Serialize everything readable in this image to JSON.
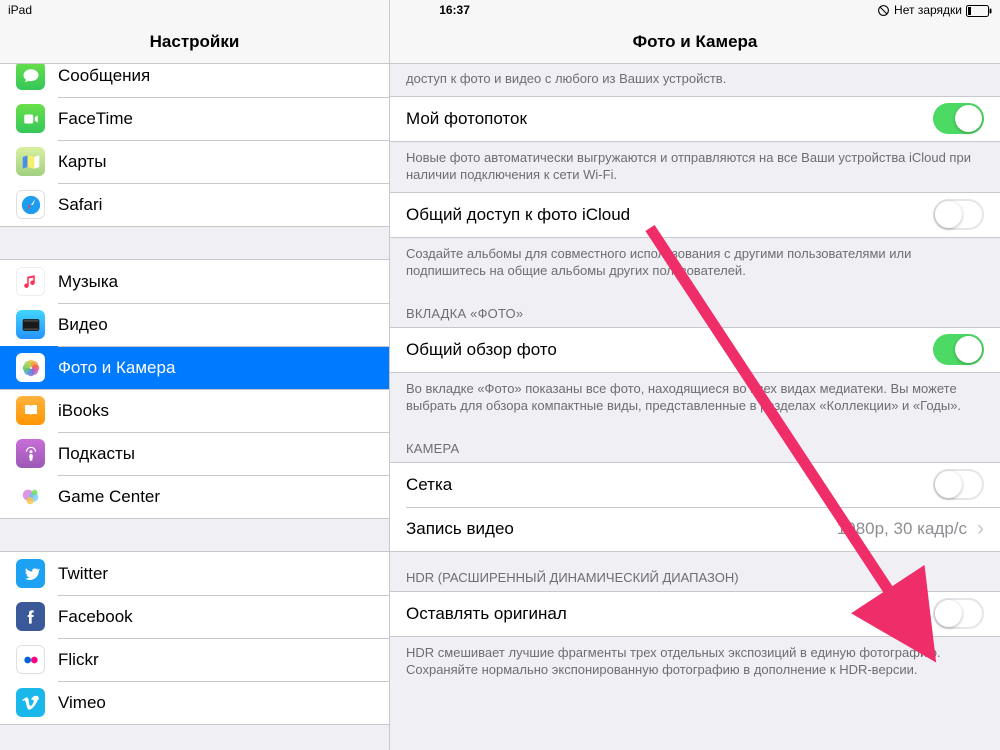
{
  "statusbar": {
    "device": "iPad",
    "time": "16:37",
    "charge_text": "Нет зарядки"
  },
  "sidebar": {
    "title": "Настройки",
    "group1": [
      {
        "id": "messages",
        "label": "Сообщения",
        "icon": "messages-icon"
      },
      {
        "id": "facetime",
        "label": "FaceTime",
        "icon": "facetime-icon"
      },
      {
        "id": "maps",
        "label": "Карты",
        "icon": "maps-icon"
      },
      {
        "id": "safari",
        "label": "Safari",
        "icon": "safari-icon"
      }
    ],
    "group2": [
      {
        "id": "music",
        "label": "Музыка",
        "icon": "music-icon"
      },
      {
        "id": "video",
        "label": "Видео",
        "icon": "video-icon"
      },
      {
        "id": "photos",
        "label": "Фото и Камера",
        "icon": "photos-icon",
        "selected": true
      },
      {
        "id": "ibooks",
        "label": "iBooks",
        "icon": "ibooks-icon"
      },
      {
        "id": "podcasts",
        "label": "Подкасты",
        "icon": "podcasts-icon"
      },
      {
        "id": "gamecenter",
        "label": "Game Center",
        "icon": "gamecenter-icon"
      }
    ],
    "group3": [
      {
        "id": "twitter",
        "label": "Twitter",
        "icon": "twitter-icon"
      },
      {
        "id": "facebook",
        "label": "Facebook",
        "icon": "facebook-icon"
      },
      {
        "id": "flickr",
        "label": "Flickr",
        "icon": "flickr-icon"
      },
      {
        "id": "vimeo",
        "label": "Vimeo",
        "icon": "vimeo-icon"
      }
    ]
  },
  "detail": {
    "title": "Фото и Камера",
    "icloud_library_footer": "доступ к фото и видео с любого из Ваших устройств.",
    "photostream": {
      "label": "Мой фотопоток",
      "on": true,
      "footer": "Новые фото автоматически выгружаются и отправляются на все Ваши устройства iCloud при наличии подключения к сети Wi-Fi."
    },
    "icloud_sharing": {
      "label": "Общий доступ к фото iCloud",
      "on": false,
      "footer": "Создайте альбомы для совместного использования с другими пользователями или подпишитесь на общие альбомы других пользователей."
    },
    "photos_tab": {
      "header": "ВКЛАДКА «ФОТО»",
      "summary_label": "Общий обзор фото",
      "summary_on": true,
      "footer": "Во вкладке «Фото» показаны все фото, находящиеся во всех видах медиатеки. Вы можете выбрать для обзора компактные виды, представленные в разделах «Коллекции» и «Годы»."
    },
    "camera": {
      "header": "КАМЕРА",
      "grid_label": "Сетка",
      "grid_on": false,
      "record_label": "Запись видео",
      "record_value": "1080p, 30 кадр/с"
    },
    "hdr": {
      "header": "HDR (РАСШИРЕННЫЙ ДИНАМИЧЕСКИЙ ДИАПАЗОН)",
      "keep_label": "Оставлять оригинал",
      "keep_on": false,
      "footer": "HDR смешивает лучшие фрагменты трех отдельных экспозиций в единую фотографию. Сохраняйте нормально экспонированную фотографию в дополнение к HDR-версии."
    }
  },
  "colors": {
    "accent_blue": "#007aff",
    "switch_green": "#4cd964",
    "annotation_arrow": "#ef2d68"
  }
}
